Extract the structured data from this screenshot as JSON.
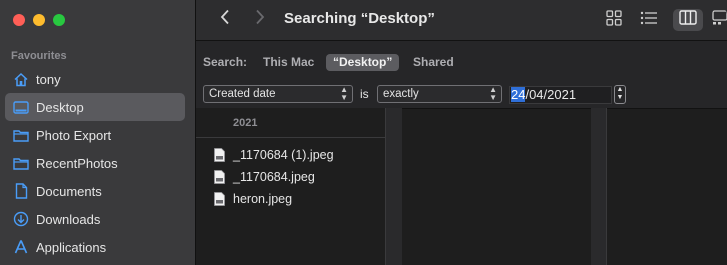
{
  "window": {
    "title": "Searching “Desktop”"
  },
  "sidebar": {
    "section_label": "Favourites",
    "items": [
      {
        "label": "tony",
        "icon": "home-icon"
      },
      {
        "label": "Desktop",
        "icon": "desktop-icon"
      },
      {
        "label": "Photo Export",
        "icon": "folder-icon"
      },
      {
        "label": "RecentPhotos",
        "icon": "folder-icon"
      },
      {
        "label": "Documents",
        "icon": "document-icon"
      },
      {
        "label": "Downloads",
        "icon": "download-icon"
      },
      {
        "label": "Applications",
        "icon": "applications-icon"
      }
    ],
    "selected": "Desktop"
  },
  "toolbar": {
    "back_icon": "chevron-left-icon",
    "forward_icon": "chevron-right-icon",
    "view_icons": [
      "icon-grid-icon",
      "list-view-icon",
      "column-view-icon",
      "gallery-view-icon"
    ],
    "active_view": "column-view-icon"
  },
  "search": {
    "label": "Search:",
    "scopes": [
      "This Mac",
      "“Desktop”",
      "Shared"
    ],
    "active_scope": "“Desktop”"
  },
  "criteria": {
    "attribute": "Created date",
    "operator_label": "is",
    "comparison": "exactly",
    "date_day": "24",
    "date_rest": "/04/2021"
  },
  "results": {
    "group_header": "2021",
    "files": [
      "_1170684 (1).jpeg",
      "_1170684.jpeg",
      "heron.jpeg"
    ]
  },
  "colors": {
    "sidebar_bg": "#3a3a3c",
    "content_bg": "#1e1e1e",
    "selection_blue": "#2f6fd8"
  }
}
